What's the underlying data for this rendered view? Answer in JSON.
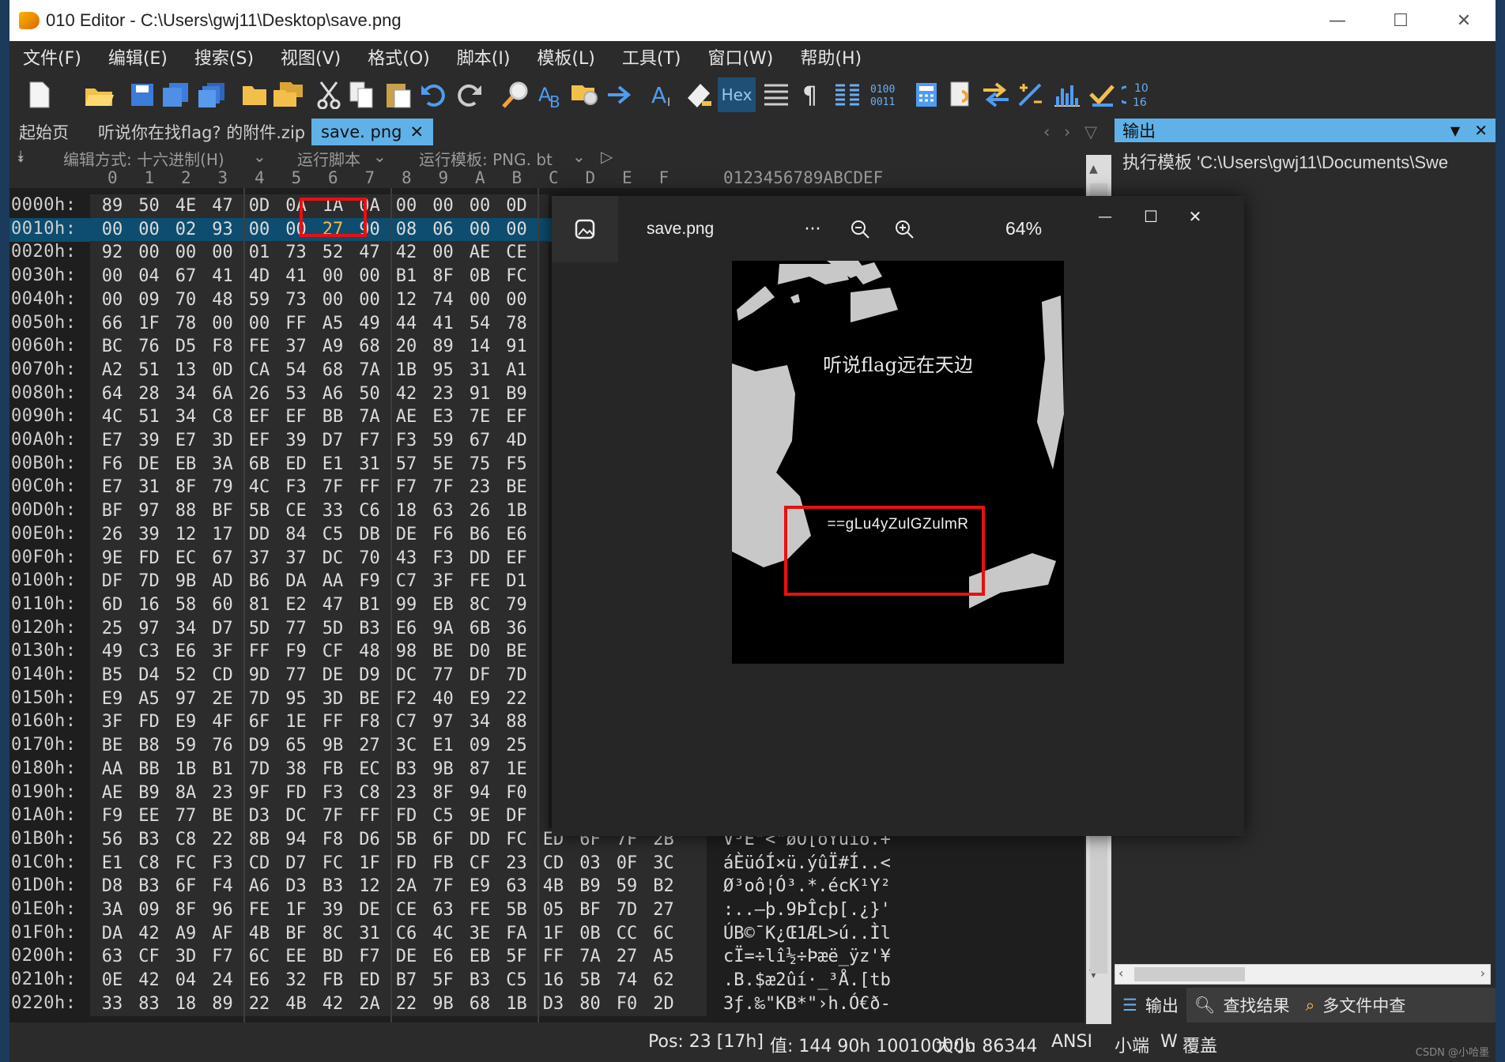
{
  "window": {
    "title": "010 Editor - C:\\Users\\gwj11\\Desktop\\save.png",
    "minimize": "—",
    "maximize": "☐",
    "close": "✕"
  },
  "menu": [
    "文件(F)",
    "编辑(E)",
    "搜索(S)",
    "视图(V)",
    "格式(O)",
    "脚本(I)",
    "模板(L)",
    "工具(T)",
    "窗口(W)",
    "帮助(H)"
  ],
  "toolbar": {
    "hex_label": "Hex"
  },
  "tabs": {
    "start": "起始页",
    "zip": "听说你在找flag? 的附件.zip",
    "active": "save. png",
    "active_close": "✕"
  },
  "hexbar": {
    "edit_mode": "编辑方式: 十六进制(H)",
    "run_script": "运行脚本",
    "run_template": "运行模板: PNG. bt"
  },
  "column_header": {
    "cols": [
      "0",
      "1",
      "2",
      "3",
      "4",
      "5",
      "6",
      "7",
      "8",
      "9",
      "A",
      "B",
      "C",
      "D",
      "E",
      "F"
    ],
    "ascii": "0123456789ABCDEF"
  },
  "hex_rows": [
    {
      "addr": "0000h:",
      "bytes": [
        "89",
        "50",
        "4E",
        "47",
        "0D",
        "0A",
        "1A",
        "0A",
        "00",
        "00",
        "00",
        "0D"
      ],
      "ascii": ""
    },
    {
      "addr": "0010h:",
      "bytes": [
        "00",
        "00",
        "02",
        "93",
        "00",
        "00",
        "27",
        "90",
        "08",
        "06",
        "00",
        "00"
      ],
      "ascii": ""
    },
    {
      "addr": "0020h:",
      "bytes": [
        "92",
        "00",
        "00",
        "00",
        "01",
        "73",
        "52",
        "47",
        "42",
        "00",
        "AE",
        "CE"
      ],
      "ascii": ""
    },
    {
      "addr": "0030h:",
      "bytes": [
        "00",
        "04",
        "67",
        "41",
        "4D",
        "41",
        "00",
        "00",
        "B1",
        "8F",
        "0B",
        "FC"
      ],
      "ascii": ""
    },
    {
      "addr": "0040h:",
      "bytes": [
        "00",
        "09",
        "70",
        "48",
        "59",
        "73",
        "00",
        "00",
        "12",
        "74",
        "00",
        "00"
      ],
      "ascii": ""
    },
    {
      "addr": "0050h:",
      "bytes": [
        "66",
        "1F",
        "78",
        "00",
        "00",
        "FF",
        "A5",
        "49",
        "44",
        "41",
        "54",
        "78"
      ],
      "ascii": ""
    },
    {
      "addr": "0060h:",
      "bytes": [
        "BC",
        "76",
        "D5",
        "F8",
        "FE",
        "37",
        "A9",
        "68",
        "20",
        "89",
        "14",
        "91"
      ],
      "ascii": ""
    },
    {
      "addr": "0070h:",
      "bytes": [
        "A2",
        "51",
        "13",
        "0D",
        "CA",
        "54",
        "68",
        "7A",
        "1B",
        "95",
        "31",
        "A1"
      ],
      "ascii": ""
    },
    {
      "addr": "0080h:",
      "bytes": [
        "64",
        "28",
        "34",
        "6A",
        "26",
        "53",
        "A6",
        "50",
        "42",
        "23",
        "91",
        "B9"
      ],
      "ascii": ""
    },
    {
      "addr": "0090h:",
      "bytes": [
        "4C",
        "51",
        "34",
        "C8",
        "EF",
        "EF",
        "BB",
        "7A",
        "AE",
        "E3",
        "7E",
        "EF"
      ],
      "ascii": ""
    },
    {
      "addr": "00A0h:",
      "bytes": [
        "E7",
        "39",
        "E7",
        "3D",
        "EF",
        "39",
        "D7",
        "F7",
        "F3",
        "59",
        "67",
        "4D"
      ],
      "ascii": ""
    },
    {
      "addr": "00B0h:",
      "bytes": [
        "F6",
        "DE",
        "EB",
        "3A",
        "6B",
        "ED",
        "E1",
        "31",
        "57",
        "5E",
        "75",
        "F5"
      ],
      "ascii": ""
    },
    {
      "addr": "00C0h:",
      "bytes": [
        "E7",
        "31",
        "8F",
        "79",
        "4C",
        "F3",
        "7F",
        "FF",
        "F7",
        "7F",
        "23",
        "BE"
      ],
      "ascii": ""
    },
    {
      "addr": "00D0h:",
      "bytes": [
        "BF",
        "97",
        "88",
        "BF",
        "5B",
        "CE",
        "33",
        "C6",
        "18",
        "63",
        "26",
        "1B"
      ],
      "ascii": ""
    },
    {
      "addr": "00E0h:",
      "bytes": [
        "26",
        "39",
        "12",
        "17",
        "DD",
        "84",
        "C5",
        "DB",
        "DE",
        "F6",
        "B6",
        "E6"
      ],
      "ascii": ""
    },
    {
      "addr": "00F0h:",
      "bytes": [
        "9E",
        "FD",
        "EC",
        "67",
        "37",
        "37",
        "DC",
        "70",
        "43",
        "F3",
        "DD",
        "EF"
      ],
      "ascii": ""
    },
    {
      "addr": "0100h:",
      "bytes": [
        "DF",
        "7D",
        "9B",
        "AD",
        "B6",
        "DA",
        "AA",
        "F9",
        "C7",
        "3F",
        "FE",
        "D1"
      ],
      "ascii": ""
    },
    {
      "addr": "0110h:",
      "bytes": [
        "6D",
        "16",
        "58",
        "60",
        "81",
        "E2",
        "47",
        "B1",
        "99",
        "EB",
        "8C",
        "79"
      ],
      "ascii": ""
    },
    {
      "addr": "0120h:",
      "bytes": [
        "25",
        "97",
        "34",
        "D7",
        "5D",
        "77",
        "5D",
        "B3",
        "E6",
        "9A",
        "6B",
        "36"
      ],
      "ascii": ""
    },
    {
      "addr": "0130h:",
      "bytes": [
        "49",
        "C3",
        "E6",
        "3F",
        "FF",
        "F9",
        "CF",
        "48",
        "98",
        "BE",
        "D0",
        "BE"
      ],
      "ascii": ""
    },
    {
      "addr": "0140h:",
      "bytes": [
        "B5",
        "D4",
        "52",
        "CD",
        "9D",
        "77",
        "DE",
        "D9",
        "DC",
        "77",
        "DF",
        "7D"
      ],
      "ascii": ""
    },
    {
      "addr": "0150h:",
      "bytes": [
        "E9",
        "A5",
        "97",
        "2E",
        "7D",
        "95",
        "3D",
        "BE",
        "F2",
        "40",
        "E9",
        "22"
      ],
      "ascii": ""
    },
    {
      "addr": "0160h:",
      "bytes": [
        "3F",
        "FD",
        "E9",
        "4F",
        "6F",
        "1E",
        "FF",
        "F8",
        "C7",
        "97",
        "34",
        "88"
      ],
      "ascii": ""
    },
    {
      "addr": "0170h:",
      "bytes": [
        "BE",
        "B8",
        "59",
        "76",
        "D9",
        "65",
        "9B",
        "27",
        "3C",
        "E1",
        "09",
        "25"
      ],
      "ascii": ""
    },
    {
      "addr": "0180h:",
      "bytes": [
        "AA",
        "BB",
        "1B",
        "B1",
        "7D",
        "38",
        "FB",
        "EC",
        "B3",
        "9B",
        "87",
        "1E"
      ],
      "ascii": ""
    },
    {
      "addr": "0190h:",
      "bytes": [
        "AE",
        "B9",
        "8A",
        "23",
        "9F",
        "FD",
        "F3",
        "C8",
        "23",
        "8F",
        "94",
        "F0"
      ],
      "ascii": ""
    },
    {
      "addr": "01A0h:",
      "bytes": [
        "F9",
        "EE",
        "77",
        "BE",
        "D3",
        "DC",
        "7F",
        "FF",
        "FD",
        "C5",
        "9E",
        "DF"
      ],
      "ascii": ""
    },
    {
      "addr": "01B0h:",
      "bytes": [
        "56",
        "B3",
        "C8",
        "22",
        "8B",
        "94",
        "F8",
        "D6",
        "5B",
        "6F",
        "DD",
        "FC",
        "ED",
        "6F",
        "7F",
        "2B"
      ],
      "ascii": "V³È\"<\"øÖ[oÝüío.+"
    },
    {
      "addr": "01C0h:",
      "bytes": [
        "E1",
        "C8",
        "FC",
        "F3",
        "CD",
        "D7",
        "FC",
        "1F",
        "FD",
        "FB",
        "CF",
        "23",
        "CD",
        "03",
        "0F",
        "3C"
      ],
      "ascii": "áÈüóÍ×ü.ýûÏ#Í..<"
    },
    {
      "addr": "01D0h:",
      "bytes": [
        "D8",
        "B3",
        "6F",
        "F4",
        "A6",
        "D3",
        "B3",
        "12",
        "2A",
        "7F",
        "E9",
        "63",
        "4B",
        "B9",
        "59",
        "B2"
      ],
      "ascii": "Ø³oô¦Ó³.*.écK¹Y²"
    },
    {
      "addr": "01E0h:",
      "bytes": [
        "3A",
        "09",
        "8F",
        "96",
        "FE",
        "1F",
        "39",
        "DE",
        "CE",
        "63",
        "FE",
        "5B",
        "05",
        "BF",
        "7D",
        "27"
      ],
      "ascii": ":..–þ.9ÞÎcþ[.¿}'"
    },
    {
      "addr": "01F0h:",
      "bytes": [
        "DA",
        "42",
        "A9",
        "AF",
        "4B",
        "BF",
        "8C",
        "31",
        "C6",
        "4C",
        "3E",
        "FA",
        "1F",
        "0B",
        "CC",
        "6C"
      ],
      "ascii": "ÚB©¯K¿Œ1ÆL>ú..Ìl"
    },
    {
      "addr": "0200h:",
      "bytes": [
        "63",
        "CF",
        "3D",
        "F7",
        "6C",
        "EE",
        "BD",
        "F7",
        "DE",
        "E6",
        "EB",
        "5F",
        "FF",
        "7A",
        "27",
        "A5"
      ],
      "ascii": "cÏ=÷lî½÷Þæë_ÿz'¥"
    },
    {
      "addr": "0210h:",
      "bytes": [
        "0E",
        "42",
        "04",
        "24",
        "E6",
        "32",
        "FB",
        "ED",
        "B7",
        "5F",
        "B3",
        "C5",
        "16",
        "5B",
        "74",
        "62"
      ],
      "ascii": ".B.$æ2ûí·_³Å.[tb"
    },
    {
      "addr": "0220h:",
      "bytes": [
        "33",
        "83",
        "18",
        "89",
        "22",
        "4B",
        "42",
        "2A",
        "22",
        "9B",
        "68",
        "1B",
        "D3",
        "80",
        "F0",
        "2D"
      ],
      "ascii": "3ƒ.‰\"KB*\"›h.Ó€ð-"
    }
  ],
  "output_panel": {
    "title": "输出",
    "dropdown": "▼",
    "close": "✕",
    "text": "执行模板 'C:\\Users\\gwj11\\Documents\\Swe"
  },
  "bottom_tabs": [
    "输出",
    "查找结果",
    "多文件中查"
  ],
  "status": {
    "pos": "Pos: 23 [17h]",
    "value": "值: 144 90h 10010000b",
    "size": "大小: 86344",
    "encoding": "ANSI",
    "endian": "小端",
    "w": "W",
    "mode": "覆盖"
  },
  "viewer": {
    "title": "save.png",
    "more": "···",
    "zoom": "64%",
    "image_text_top": "听说flag远在天边",
    "image_text_flag": "==gLu4yZulGZulmR"
  },
  "watermark": "CSDN @小哈墨",
  "colors": {
    "accent": "#5fb1e8",
    "highlight_box": "#e81010",
    "selected_row": "#0e4d6f",
    "changed_byte": "#ffb84d"
  }
}
